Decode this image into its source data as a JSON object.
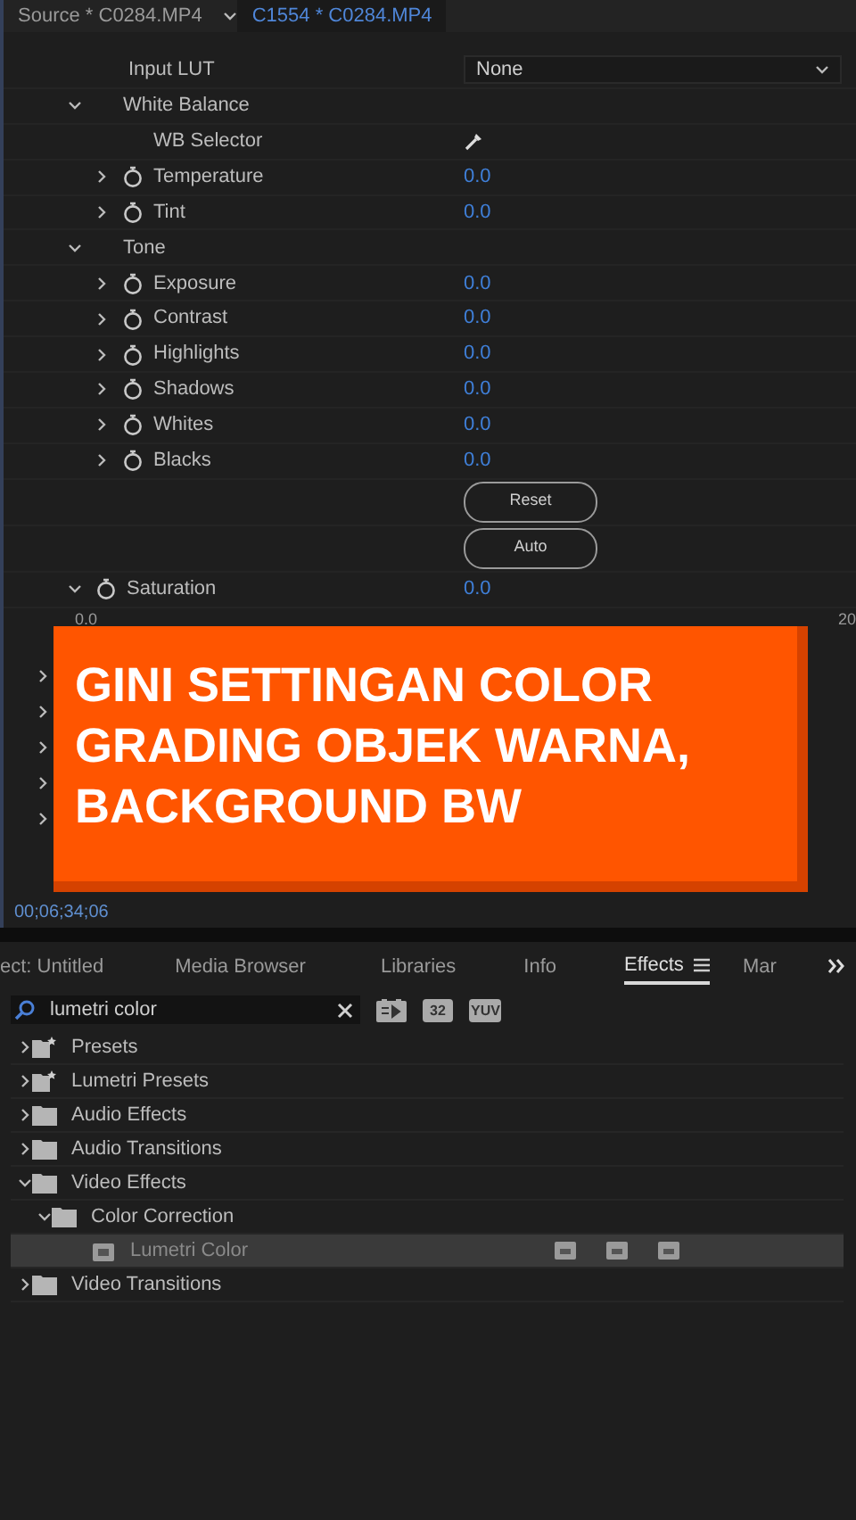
{
  "source_tabs": [
    {
      "label": "Source * C0284.MP4",
      "selected": false
    },
    {
      "label": "C1554 * C0284.MP4",
      "selected": true
    }
  ],
  "lumetri": {
    "rows": [
      {
        "kind": "dropdown",
        "label": "Input LUT",
        "value": "None"
      },
      {
        "kind": "group",
        "label": "White Balance",
        "expanded": true,
        "children": [
          {
            "kind": "eyedropper",
            "label": "WB Selector"
          },
          {
            "kind": "value",
            "label": "Temperature",
            "value": "0.0",
            "expanded": false
          },
          {
            "kind": "value",
            "label": "Tint",
            "value": "0.0",
            "expanded": false
          }
        ]
      },
      {
        "kind": "group",
        "label": "Tone",
        "expanded": true,
        "children": [
          {
            "kind": "value",
            "label": "Exposure",
            "value": "0.0",
            "expanded": false
          },
          {
            "kind": "value",
            "label": "Contrast",
            "value": "0.0",
            "expanded": false
          },
          {
            "kind": "value",
            "label": "Highlights",
            "value": "0.0",
            "expanded": false
          },
          {
            "kind": "value",
            "label": "Shadows",
            "value": "0.0",
            "expanded": false
          },
          {
            "kind": "value",
            "label": "Whites",
            "value": "0.0",
            "expanded": false
          },
          {
            "kind": "value",
            "label": "Blacks",
            "value": "0.0",
            "expanded": false
          },
          {
            "kind": "button",
            "label": "Reset"
          },
          {
            "kind": "button",
            "label": "Auto"
          }
        ]
      },
      {
        "kind": "value",
        "label": "Saturation",
        "value": "0.0",
        "expanded": true
      }
    ],
    "slider_min": "0.0",
    "slider_max": "20",
    "hidden_rows": [
      {
        "expanded": false
      },
      {
        "expanded": false
      },
      {
        "expanded": false
      },
      {
        "expanded": false
      },
      {
        "expanded": false
      }
    ]
  },
  "timecode": "00;06;34;06",
  "overlay_caption": "GINI SETTINGAN COLOR GRADING OBJEK WARNA, BACKGROUND BW",
  "panel_tabs": [
    {
      "label": "ect: Untitled",
      "selected": false
    },
    {
      "label": "Media Browser",
      "selected": false
    },
    {
      "label": "Libraries",
      "selected": false
    },
    {
      "label": "Info",
      "selected": false
    },
    {
      "label": "Effects",
      "selected": true
    },
    {
      "label": "Mar",
      "selected": false
    }
  ],
  "search": {
    "value": "lumetri color"
  },
  "filter_badges": [
    "32",
    "YUV"
  ],
  "effects_tree": [
    {
      "label": "Presets",
      "kind": "preset-folder",
      "expanded": false
    },
    {
      "label": "Lumetri Presets",
      "kind": "preset-folder",
      "expanded": false
    },
    {
      "label": "Audio Effects",
      "kind": "folder",
      "expanded": false
    },
    {
      "label": "Audio Transitions",
      "kind": "folder",
      "expanded": false
    },
    {
      "label": "Video Effects",
      "kind": "folder",
      "expanded": true,
      "children": [
        {
          "label": "Color Correction",
          "kind": "folder",
          "expanded": true,
          "children": [
            {
              "label": "Lumetri Color",
              "kind": "effect",
              "selected": true
            }
          ]
        }
      ]
    },
    {
      "label": "Video Transitions",
      "kind": "folder",
      "expanded": false
    }
  ]
}
